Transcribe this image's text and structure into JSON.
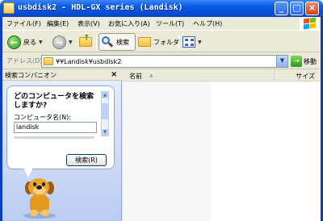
{
  "window": {
    "title": "usbdisk2 - HDL-GX series (Landisk)",
    "buttons": {
      "minimize": "_",
      "maximize": "□",
      "close": "×"
    }
  },
  "menu": {
    "items": [
      "ファイル(F)",
      "編集(E)",
      "表示(V)",
      "お気に入り(A)",
      "ツール(T)",
      "ヘルプ(H)"
    ]
  },
  "toolbar": {
    "back_label": "戻る",
    "search_label": "検索",
    "folders_label": "フォルダ"
  },
  "address": {
    "label": "アドレス(D)",
    "value": "¥¥Landisk¥usbdisk2",
    "go_label": "移動"
  },
  "search_pane": {
    "title": "検索コンパニオン",
    "close": "×",
    "question": "どのコンピュータを検索しますか?",
    "field_label": "コンピュータ名(N):",
    "field_value": "landisk",
    "search_button": "検索(R)"
  },
  "file_list": {
    "columns": [
      "名前",
      "サイズ"
    ]
  },
  "colors": {
    "titlebar": "#0551d6",
    "accent_green": "#2f9a1e",
    "pane_bg": "#b9cdf2"
  },
  "icons": [
    "window-icon",
    "back-arrow-icon",
    "forward-arrow-icon",
    "up-folder-icon",
    "search-icon",
    "folder-icon",
    "views-icon",
    "go-arrow-icon",
    "search-dog-icon",
    "windows-logo-icon"
  ]
}
